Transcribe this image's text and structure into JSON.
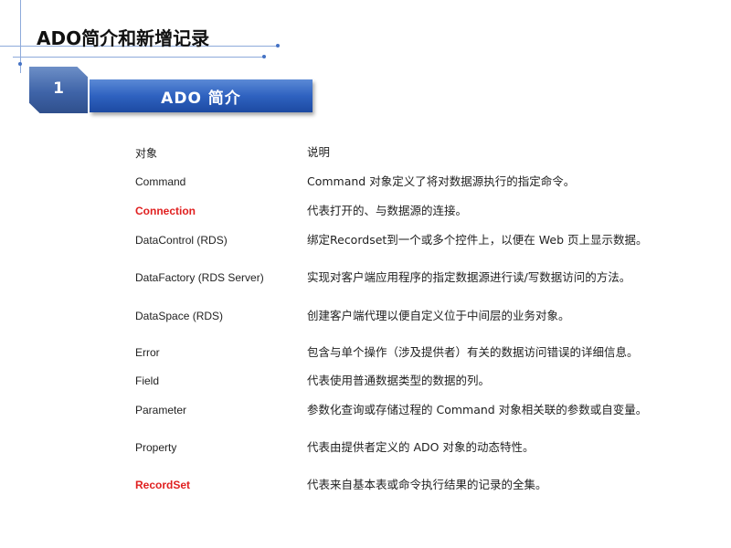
{
  "slide": {
    "title": "ADO简介和新增记录",
    "section_number": "1",
    "section_title": "ADO 简介"
  },
  "table": {
    "headers": {
      "name": "对象",
      "desc": "说明"
    },
    "rows": [
      {
        "name": "Command",
        "desc": "Command 对象定义了将对数据源执行的指定命令。",
        "highlight": false
      },
      {
        "name": "Connection",
        "desc": "代表打开的、与数据源的连接。",
        "highlight": true
      },
      {
        "name": "DataControl (RDS)",
        "desc": "绑定Recordset到一个或多个控件上，以便在 Web 页上显示数据。",
        "highlight": false
      },
      {
        "name": "DataFactory (RDS Server)",
        "desc": "实现对客户端应用程序的指定数据源进行读/写数据访问的方法。",
        "highlight": false
      },
      {
        "name": "DataSpace (RDS)",
        "desc": "创建客户端代理以便自定义位于中间层的业务对象。",
        "highlight": false
      },
      {
        "name": "Error",
        "desc": "包含与单个操作（涉及提供者）有关的数据访问错误的详细信息。",
        "highlight": false
      },
      {
        "name": "Field",
        "desc": "代表使用普通数据类型的数据的列。",
        "highlight": false
      },
      {
        "name": "Parameter",
        "desc": "参数化查询或存储过程的 Command 对象相关联的参数或自变量。",
        "highlight": false
      },
      {
        "name": "Property",
        "desc": "代表由提供者定义的 ADO 对象的动态特性。",
        "highlight": false
      },
      {
        "name": "RecordSet",
        "desc": "代表来自基本表或命令执行结果的记录的全集。",
        "highlight": true
      }
    ]
  },
  "colors": {
    "accent": "#2f62c0",
    "highlight_text": "#e02020",
    "deco_line": "#8eaadb"
  }
}
